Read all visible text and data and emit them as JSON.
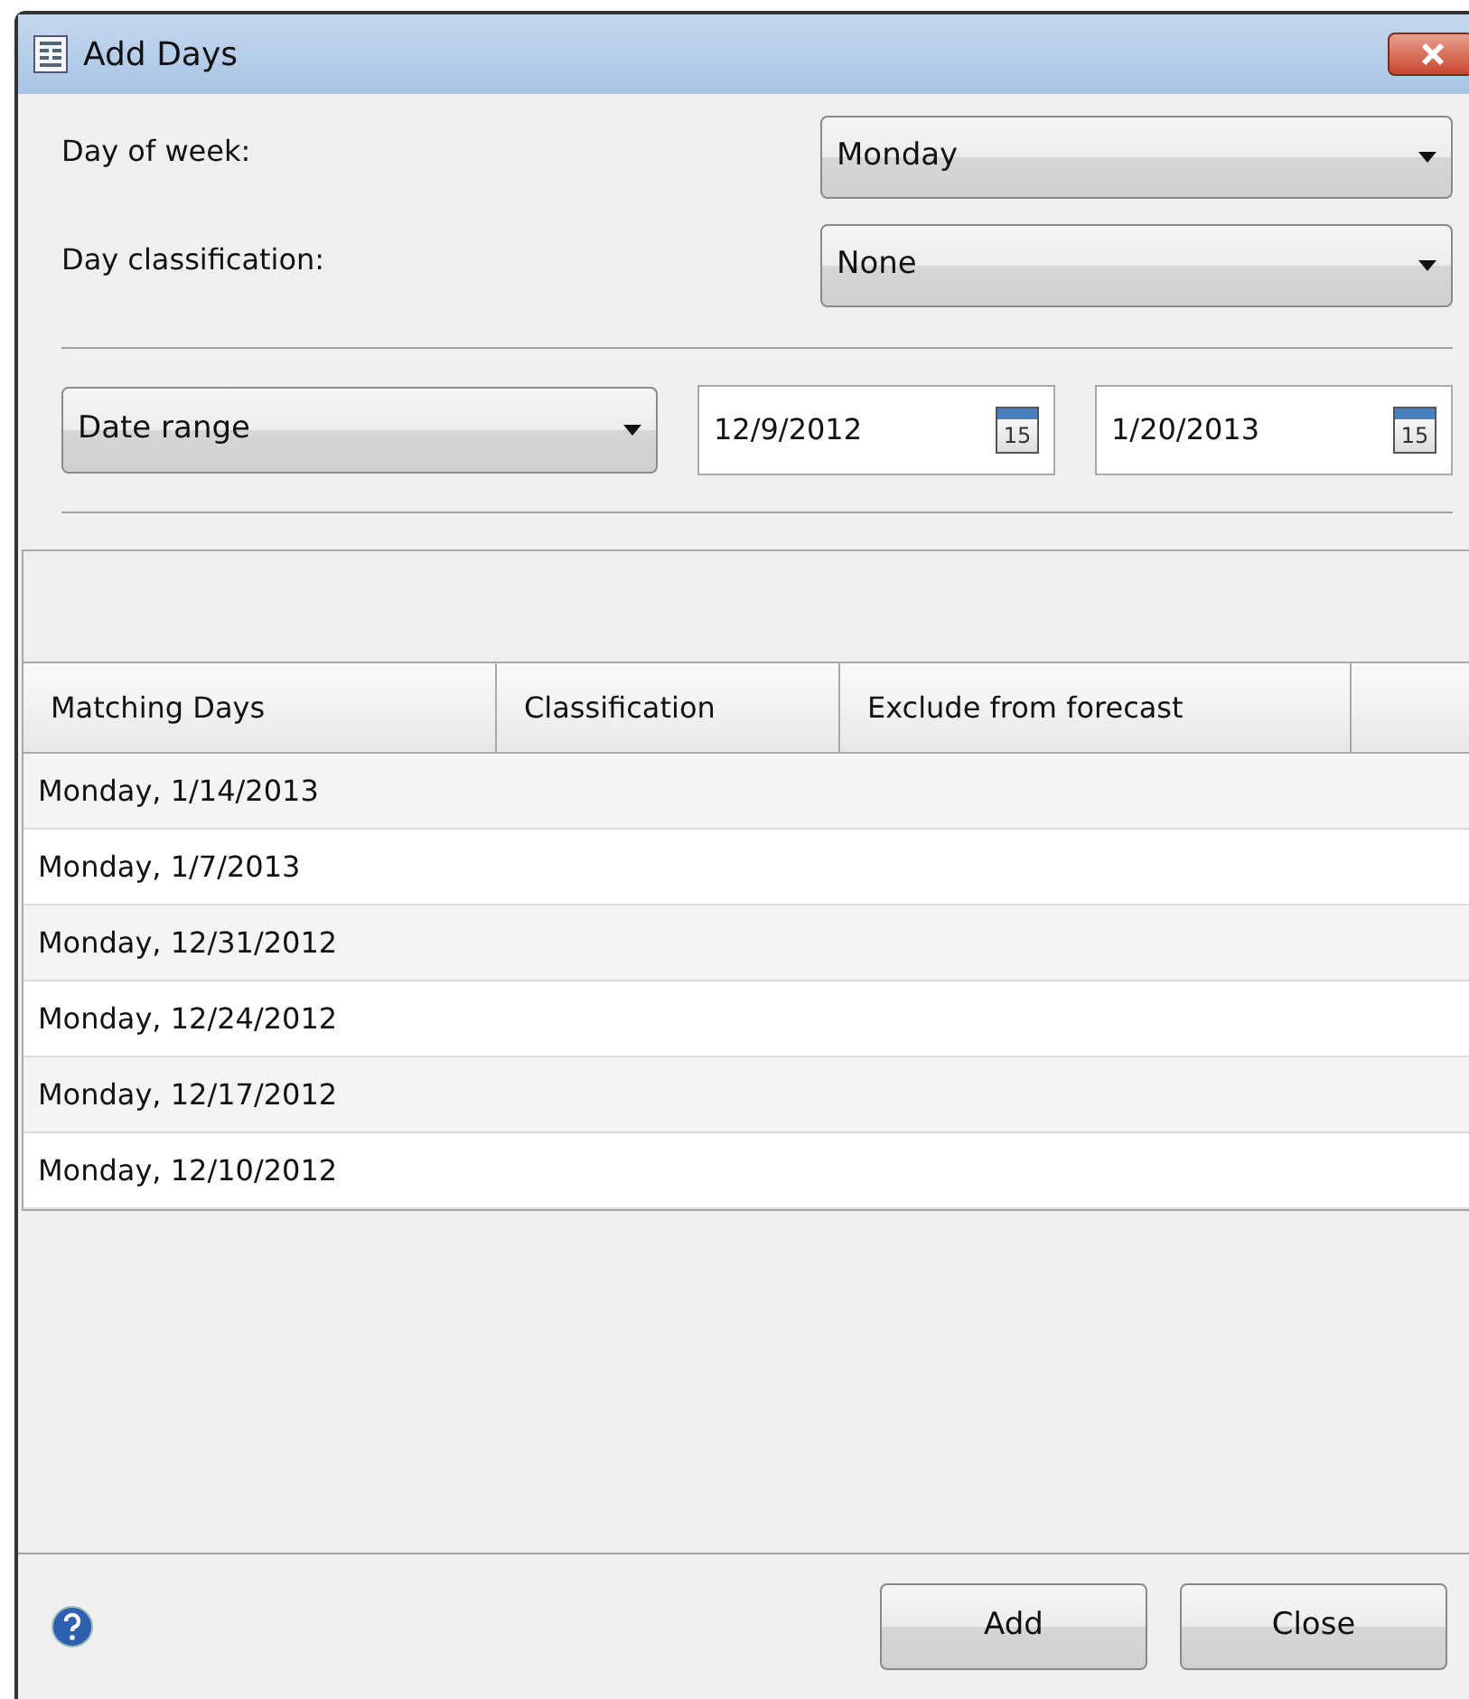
{
  "window": {
    "title": "Add Days"
  },
  "fields": [
    {
      "label": "Day of week:",
      "value": "Monday"
    },
    {
      "label": "Day classification:",
      "value": "None"
    }
  ],
  "range": {
    "mode": "Date range",
    "dates": [
      {
        "value": "12/9/2012",
        "calendar_icon_label": "15"
      },
      {
        "value": "1/20/2013",
        "calendar_icon_label": "15"
      }
    ]
  },
  "table": {
    "columns": [
      "Matching Days",
      "Classification",
      "Exclude from forecast"
    ],
    "rows": [
      [
        "Monday, 1/14/2013"
      ],
      [
        "Monday, 1/7/2013"
      ],
      [
        "Monday, 12/31/2012"
      ],
      [
        "Monday, 12/24/2012"
      ],
      [
        "Monday, 12/17/2012"
      ],
      [
        "Monday, 12/10/2012"
      ]
    ]
  },
  "buttons": [
    "Add",
    "Close"
  ]
}
